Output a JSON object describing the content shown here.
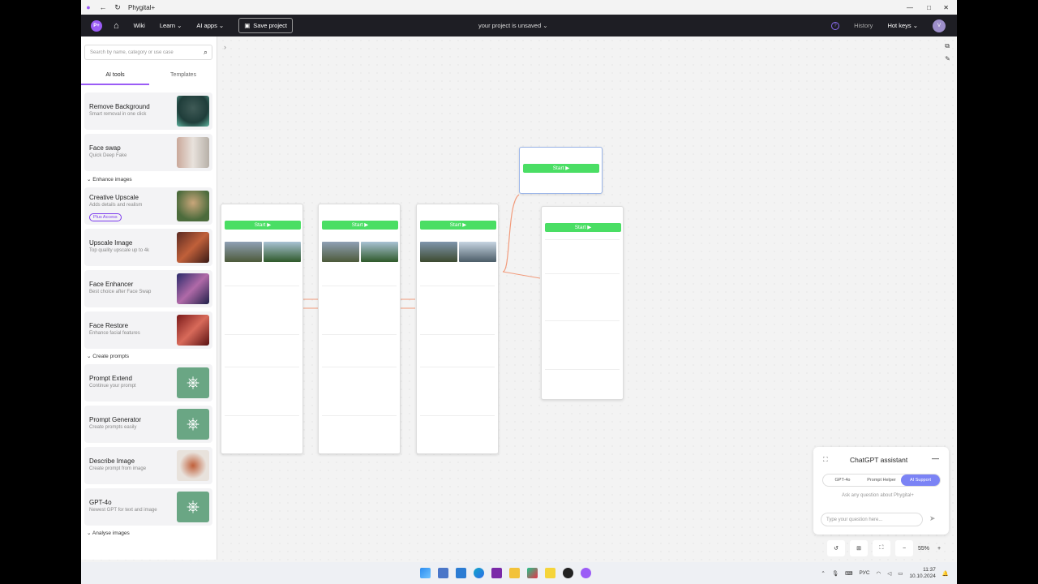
{
  "window": {
    "title": "Phygital+"
  },
  "header": {
    "home": "⌂",
    "wiki": "Wiki",
    "learn": "Learn",
    "ai_apps": "AI apps",
    "save": "Save project",
    "status": "your project is unsaved",
    "history": "History",
    "hotkeys": "Hot keys",
    "avatar": "V",
    "logo": "P+"
  },
  "sidebar": {
    "search_placeholder": "Search by name, category or use case",
    "tabs": [
      "AI tools",
      "Templates"
    ],
    "cards": [
      {
        "title": "Remove Background",
        "desc": "Smart removal in one click"
      },
      {
        "title": "Face swap",
        "desc": "Quick Deep Fake"
      },
      {
        "title": "Creative Upscale",
        "desc": "Adds details and realism",
        "badge": "Plus Access"
      },
      {
        "title": "Upscale Image",
        "desc": "Top quality upscale up to 4k"
      },
      {
        "title": "Face Enhancer",
        "desc": "Best choice after Face Swap"
      },
      {
        "title": "Face Restore",
        "desc": "Enhance facial features"
      },
      {
        "title": "Prompt Extend",
        "desc": "Continue your prompt"
      },
      {
        "title": "Prompt Generator",
        "desc": "Create prompts easily"
      },
      {
        "title": "Describe Image",
        "desc": "Create prompt from image"
      },
      {
        "title": "GPT-4o",
        "desc": "Newest GPT for text and image"
      }
    ],
    "sections": [
      "Enhance images",
      "Create prompts",
      "Analyse images"
    ]
  },
  "nodes": {
    "start": "Start ▶"
  },
  "chat": {
    "title": "ChatGPT assistant",
    "tabs": [
      "GPT-4o",
      "Prompt Helper",
      "AI Support"
    ],
    "ask": "Ask any question about Phygital+",
    "placeholder": "Type your question here..."
  },
  "zoom": {
    "level": "55%"
  },
  "taskbar": {
    "lang": "РУС",
    "time": "11:37",
    "date": "10.10.2024"
  }
}
